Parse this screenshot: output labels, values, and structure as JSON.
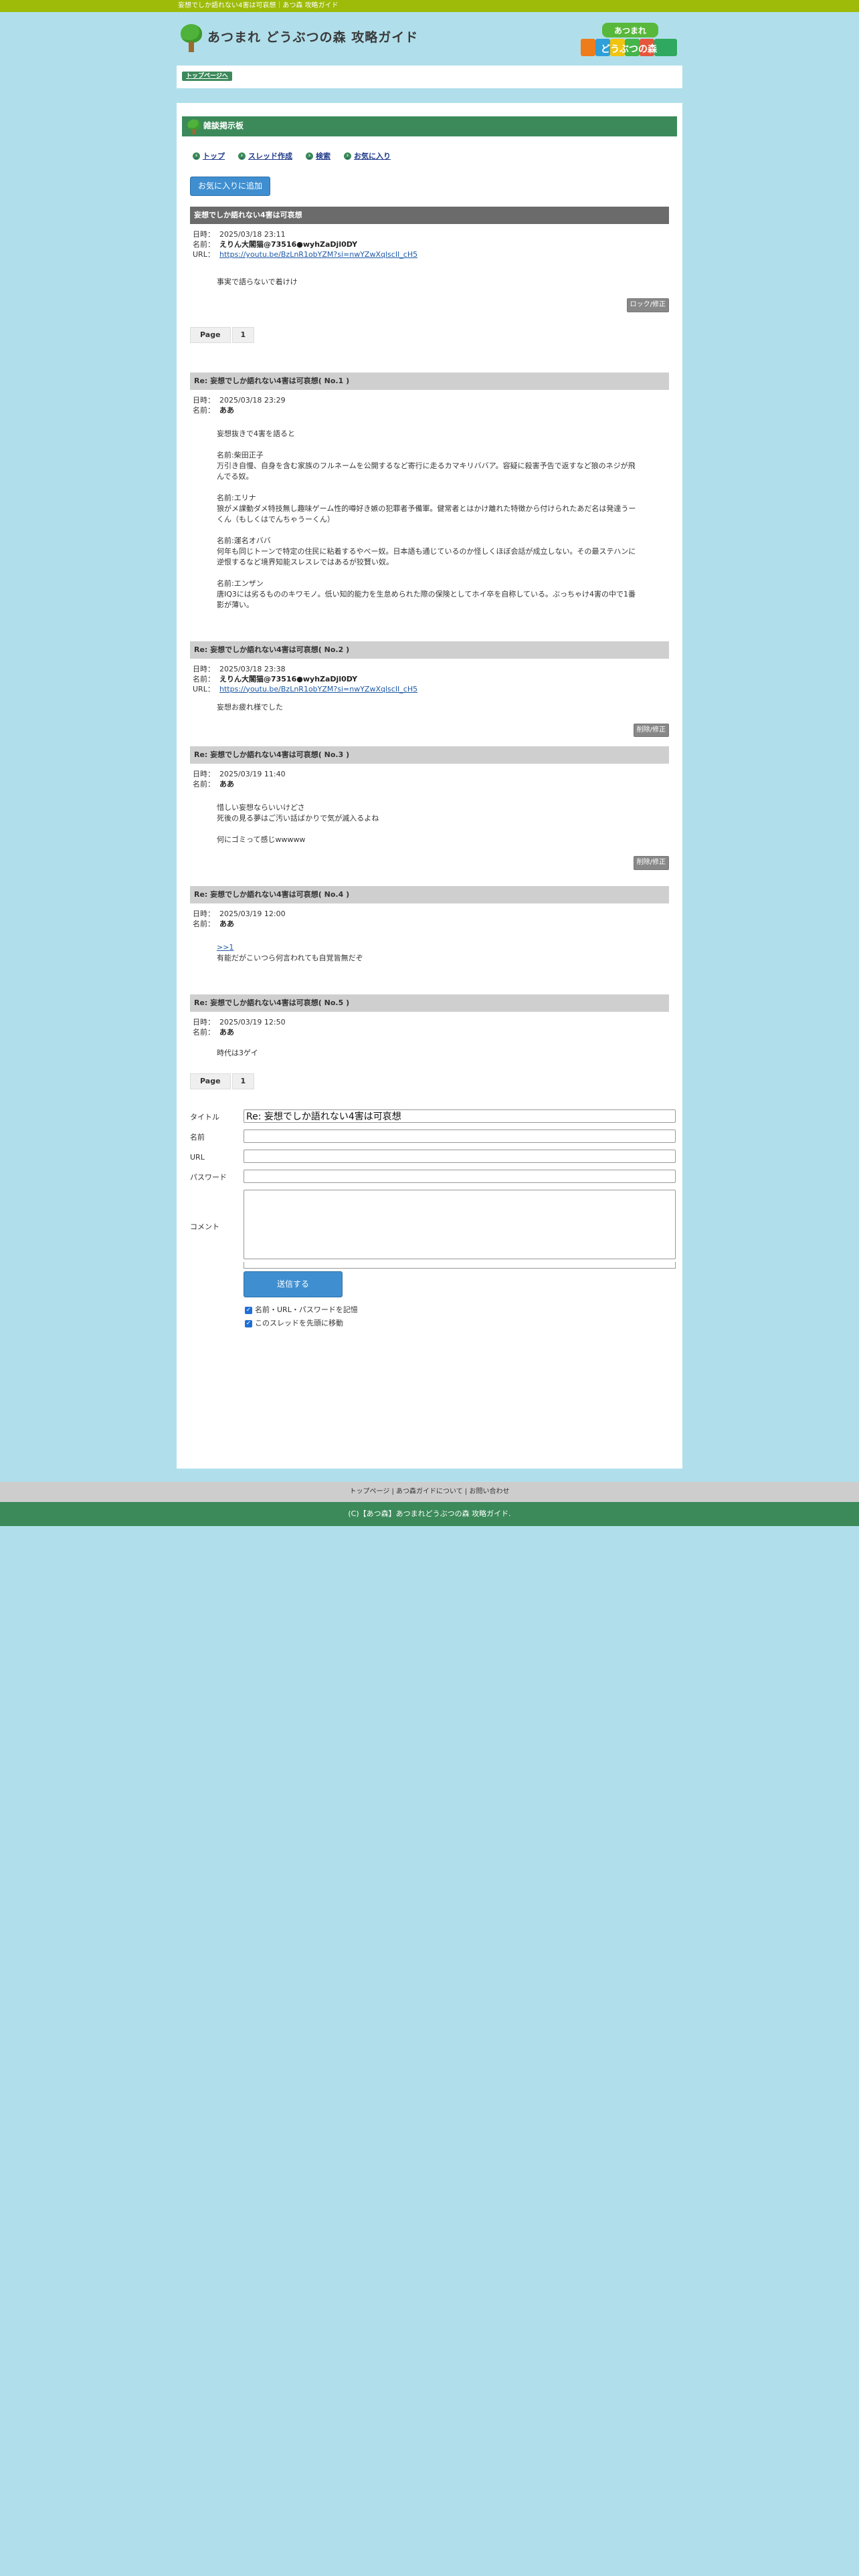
{
  "topbar": {
    "text": "妄想でしか語れない4害は可哀想｜あつ森 攻略ガイド"
  },
  "site": {
    "title": "あつまれ どうぶつの森 攻略ガイド",
    "logo_text_1": "あつまれ",
    "logo_text_2": "どうぶつの森"
  },
  "breadcrumb": {
    "label": "トップページへ"
  },
  "bbs": {
    "header": "雑談掲示板",
    "nav": [
      "トップ",
      "スレッド作成",
      "検索",
      "お気に入り"
    ],
    "fav_button": "お気に入りに追加",
    "lock_button": "ロック/修正",
    "edit_button": "削除/修正"
  },
  "thread": {
    "title": "妄想でしか語れない4害は可哀想",
    "date_label": "日時：",
    "name_label": "名前：",
    "url_label": "URL：",
    "date": "2025/03/18 23:11",
    "name": "えりん大閣猫@73516●wyhZaDjl0DY",
    "url": "https://youtu.be/BzLnR1obYZM?si=nwYZwXqlscII_cH5",
    "body": "事実で語らないで着けけ"
  },
  "pager": {
    "label": "Page",
    "page": "1"
  },
  "replies": [
    {
      "title": "Re: 妄想でしか語れない4害は可哀想( No.1 )",
      "date": "2025/03/18 23:29",
      "name": "ああ",
      "paragraphs": [
        "妄想抜きで4害を語ると",
        "名前:柴田正子\n万引き自慢、自身を含む家族のフルネームを公開するなど寄行に走るカマキリババア。容疑に殺害予告で返すなど狼のネジが飛んでる奴。",
        "名前:エリナ\n狼がメ課動ダメ特技無し趣味ゲーム性的噂好き嫉の犯罪者予備軍。健常者とはかけ離れた特徴から付けられたあだ名は発達うーくん（もしくはでんちゃうーくん）",
        "名前:運名オババ\n何年も同じトーンで特定の住民に粘着するやべー奴。日本語も通じているのか怪しくほぼ会話が成立しない。その最ステハンに逆恨するなど境界知能スレスレではあるが狡賢い奴。",
        "名前:エンザン\n唐IQ3には劣るもののキワモノ。低い知的能力を生怠められた際の保険としてホイ卒を自称している。ぶっちゃけ4害の中で1番影が薄い。"
      ]
    },
    {
      "title": "Re: 妄想でしか語れない4害は可哀想( No.2 )",
      "date": "2025/03/18 23:38",
      "name": "えりん大閣猫@73516●wyhZaDjl0DY",
      "url": "https://youtu.be/BzLnR1obYZM?si=nwYZwXqlscII_cH5",
      "paragraphs": [
        "妄想お疲れ様でした"
      ]
    },
    {
      "title": "Re: 妄想でしか語れない4害は可哀想( No.3 )",
      "date": "2025/03/19 11:40",
      "name": "ああ",
      "paragraphs": [
        "惜しい妄想ならいいけどさ\n死後の見る夢はご汚い話ばかりで気が滅入るよね",
        "何にゴミって感じwwwww"
      ]
    },
    {
      "title": "Re: 妄想でしか語れない4害は可哀想( No.4 )",
      "date": "2025/03/19 12:00",
      "name": "ああ",
      "link": ">>1",
      "paragraphs": [
        "有能だがこいつら何言われても自覚皆無だぞ"
      ]
    },
    {
      "title": "Re: 妄想でしか語れない4害は可哀想( No.5 )",
      "date": "2025/03/19 12:50",
      "name": "ああ",
      "paragraphs": [
        "時代は3ゲイ"
      ]
    }
  ],
  "form": {
    "title_label": "タイトル",
    "title_value": "Re: 妄想でしか語れない4害は可哀想",
    "name_label": "名前",
    "url_label": "URL",
    "password_label": "パスワード",
    "comment_label": "コメント",
    "submit_label": "送信する",
    "remember_label": "名前・URL・パスワードを記憶",
    "top_label": "このスレッドを先頭に移動"
  },
  "footer": {
    "links": "トップページ | あつ森ガイドについて | お問い合わせ",
    "copyright": "(C)【あつ森】あつまれどうぶつの森 攻略ガイド."
  },
  "colors": {
    "accent_green": "#3c8a5a",
    "top_green": "#9dbb08",
    "bg": "#b0dfeb",
    "button_blue": "#3f8fd0"
  }
}
